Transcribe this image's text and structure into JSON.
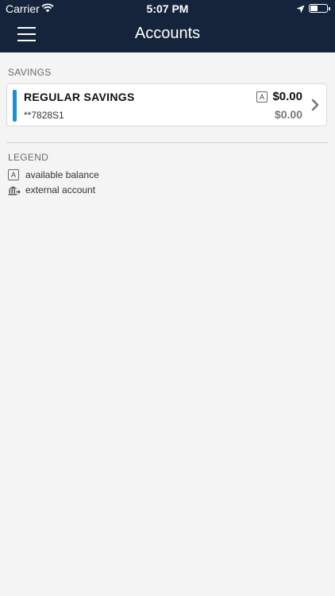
{
  "status_bar": {
    "carrier": "Carrier",
    "time": "5:07 PM",
    "icons": [
      "wifi-icon",
      "location-arrow-icon",
      "battery-icon"
    ]
  },
  "nav": {
    "title": "Accounts",
    "menu_icon": "hamburger-menu-icon"
  },
  "savings": {
    "section_label": "SAVINGS",
    "accounts": [
      {
        "name": "REGULAR SAVINGS",
        "number": "**7828S1",
        "badge": "A",
        "available_balance": "$0.00",
        "current_balance": "$0.00",
        "accent_color": "#1b8fd0"
      }
    ]
  },
  "legend": {
    "label": "LEGEND",
    "items": [
      {
        "badge": "A",
        "icon": "available-balance-icon",
        "text": "available balance"
      },
      {
        "icon": "external-account-bank-icon",
        "text": "external account"
      }
    ]
  },
  "colors": {
    "header_bg": "#15243a",
    "page_bg": "#f4f4f4",
    "accent": "#1b8fd0"
  }
}
